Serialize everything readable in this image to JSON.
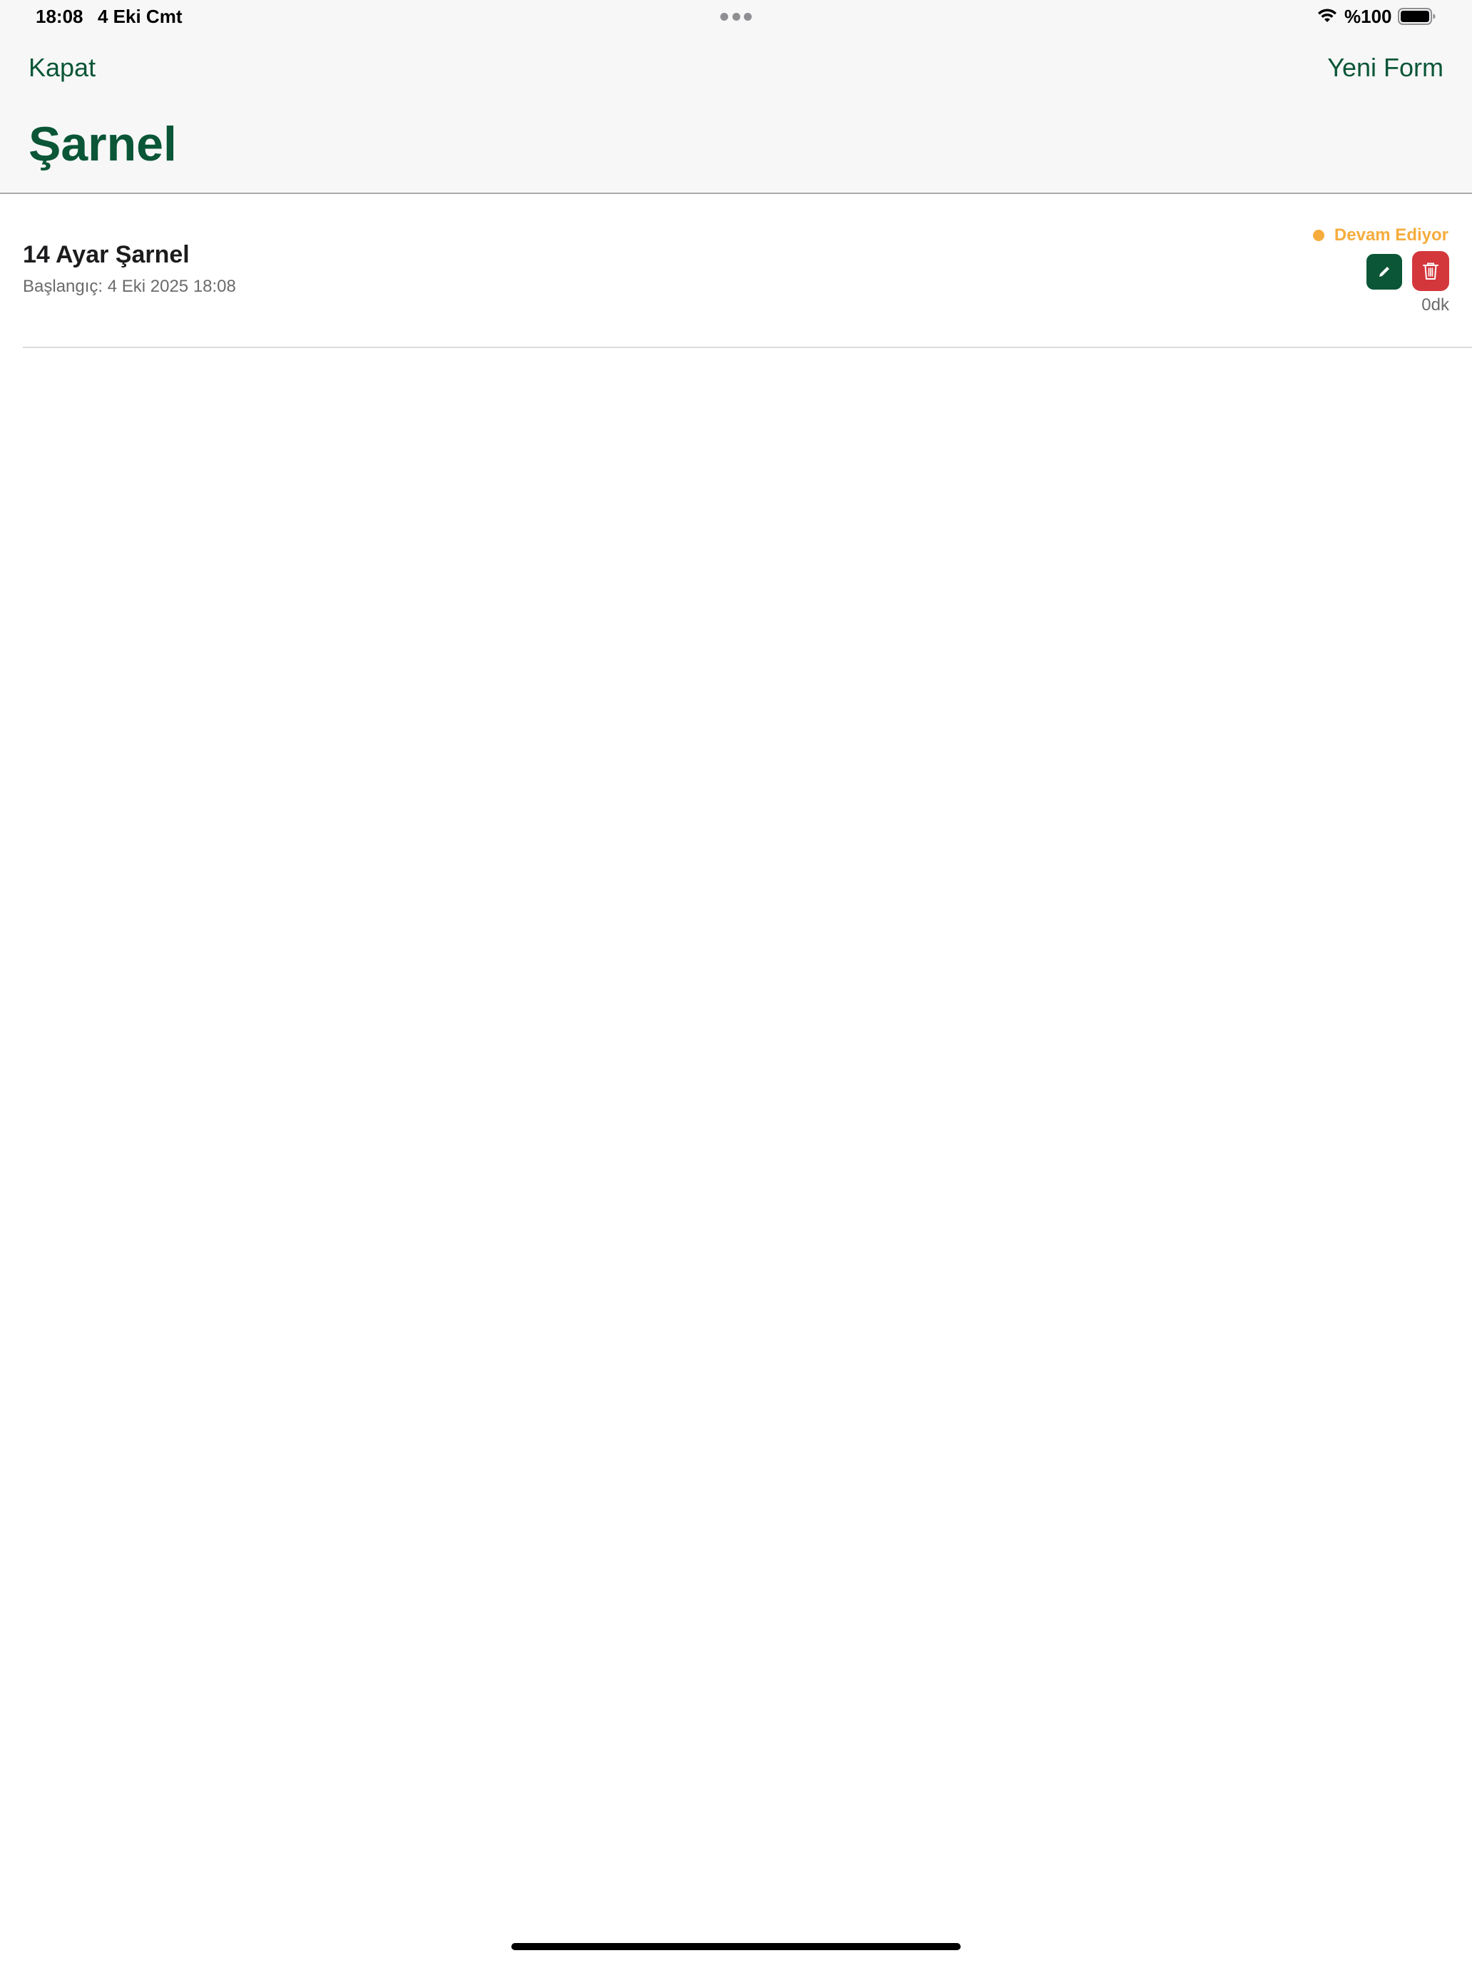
{
  "status_bar": {
    "time": "18:08",
    "date": "4 Eki Cmt",
    "battery_percent": "%100",
    "icons": [
      "wifi-icon",
      "battery-icon",
      "multitask-dots-icon"
    ]
  },
  "nav": {
    "close_label": "Kapat",
    "new_form_label": "Yeni Form"
  },
  "page": {
    "title": "Şarnel"
  },
  "list": {
    "items": [
      {
        "title": "14 Ayar Şarnel",
        "subtitle": "Başlangıç: 4 Eki 2025 18:08",
        "status": "Devam Ediyor",
        "duration": "0dk",
        "actions": [
          "pencil-icon",
          "trash-icon"
        ]
      }
    ]
  },
  "colors": {
    "accent": "#0a5637",
    "status_in_progress": "#f5ac3d",
    "delete": "#d3373c",
    "header_bg": "#f7f7f7"
  }
}
